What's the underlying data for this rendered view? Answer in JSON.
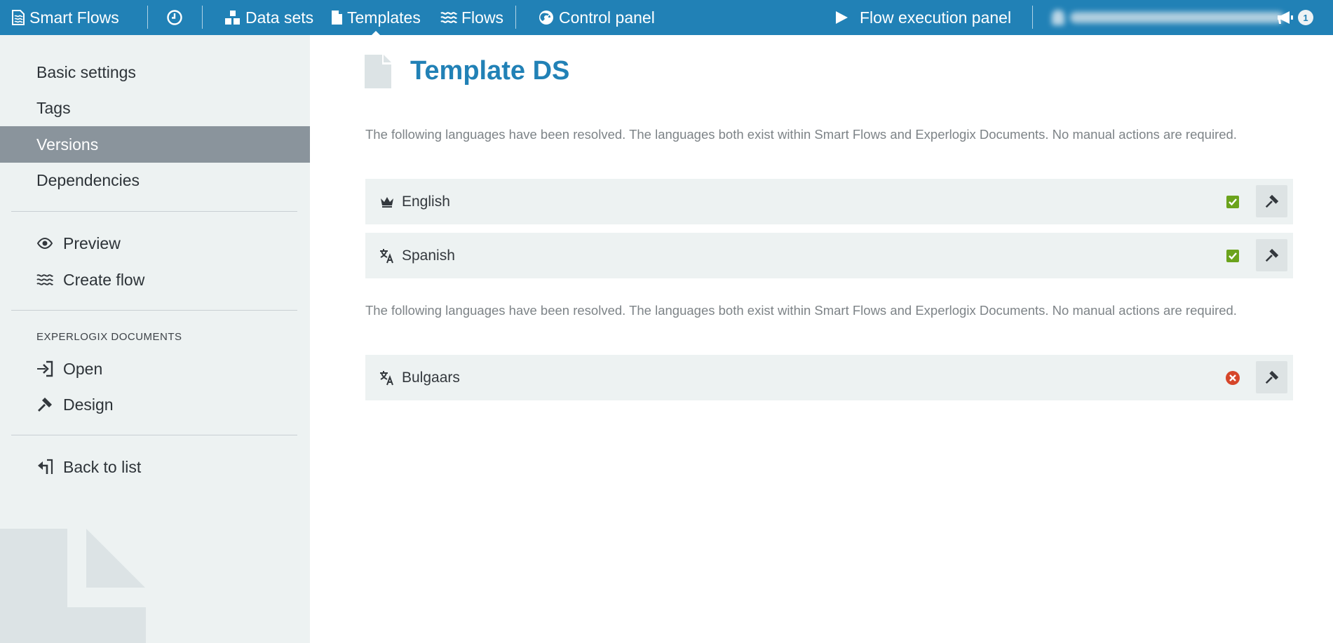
{
  "topbar": {
    "brand": "Smart Flows",
    "nav": {
      "datasets": "Data sets",
      "templates": "Templates",
      "flows": "Flows",
      "control_panel": "Control panel",
      "flow_execution": "Flow execution panel"
    },
    "notification_count": "1",
    "bar_color": "#2181b6"
  },
  "sidebar": {
    "items": [
      {
        "label": "Basic settings",
        "active": false
      },
      {
        "label": "Tags",
        "active": false
      },
      {
        "label": "Versions",
        "active": true
      },
      {
        "label": "Dependencies",
        "active": false
      }
    ],
    "actions": [
      {
        "label": "Preview",
        "icon": "eye-icon"
      },
      {
        "label": "Create flow",
        "icon": "flows-icon"
      }
    ],
    "section_title": "EXPERLOGIX DOCUMENTS",
    "doc_actions": [
      {
        "label": "Open",
        "icon": "sign-in-icon"
      },
      {
        "label": "Design",
        "icon": "gavel-icon"
      }
    ],
    "back": {
      "label": "Back to list",
      "icon": "back-arrow-icon"
    }
  },
  "main": {
    "title": "Template DS",
    "groups": [
      {
        "description": "The following languages have been resolved. The languages both exist within Smart Flows and Experlogix Documents. No manual actions are required.",
        "languages": [
          {
            "name": "English",
            "icon": "crown-icon",
            "status": "ok"
          },
          {
            "name": "Spanish",
            "icon": "translate-icon",
            "status": "ok"
          }
        ]
      },
      {
        "description": "The following languages have been resolved. The languages both exist within Smart Flows and Experlogix Documents. No manual actions are required.",
        "languages": [
          {
            "name": "Bulgaars",
            "icon": "translate-icon",
            "status": "error"
          }
        ]
      }
    ],
    "colors": {
      "ok": "#6ba31c",
      "error": "#d6462a",
      "title": "#2181b6"
    }
  }
}
